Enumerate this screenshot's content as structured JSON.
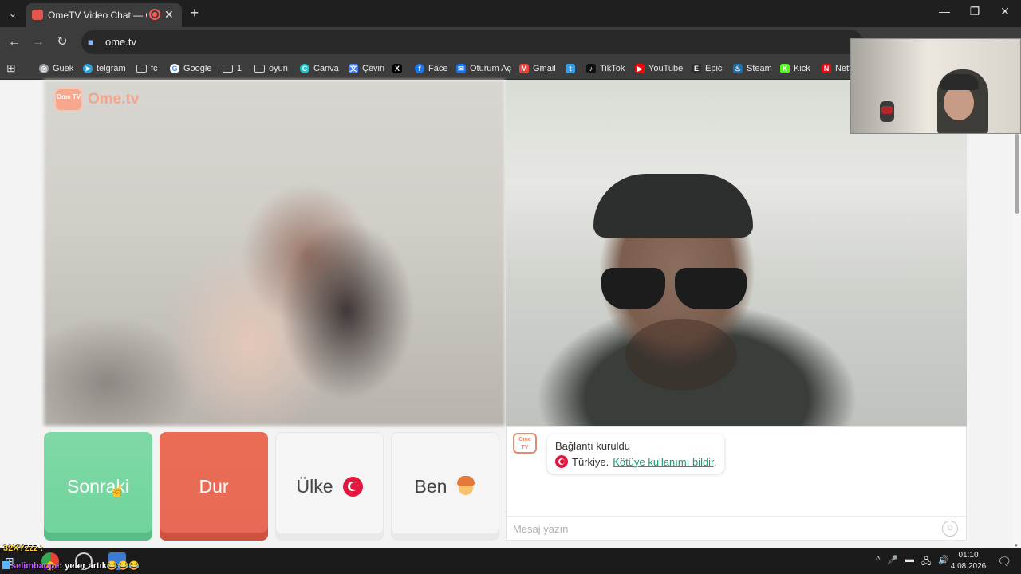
{
  "browser": {
    "tab_title": "OmeTV Video Chat — Ome",
    "tab_close": "✕",
    "new_tab": "+",
    "url": "ome.tv",
    "window_controls": {
      "minimize": "—",
      "maximize": "❐",
      "close": "✕"
    },
    "nav": {
      "back": "←",
      "forward": "→",
      "reload": "↻"
    },
    "bookmarks": [
      {
        "label": "Guek",
        "icon": "globe-icon",
        "color": "#9aa0a6"
      },
      {
        "label": "telgram",
        "icon": "telegram-icon",
        "color": "#2aa3e0"
      },
      {
        "label": "fc",
        "icon": "folder-icon",
        "color": "#3c3c3c"
      },
      {
        "label": "Google",
        "icon": "google-icon",
        "color": "#ffffff"
      },
      {
        "label": "1",
        "icon": "folder-icon",
        "color": "#3c3c3c"
      },
      {
        "label": "oyun",
        "icon": "folder-icon",
        "color": "#3c3c3c"
      },
      {
        "label": "Canva",
        "icon": "canva-icon",
        "color": "#20c4cb"
      },
      {
        "label": "Çeviri",
        "icon": "translate-icon",
        "color": "#4a7bf0"
      },
      {
        "label": "",
        "icon": "x-icon",
        "color": "#000000"
      },
      {
        "label": "Face",
        "icon": "facebook-icon",
        "color": "#1877f2"
      },
      {
        "label": "Oturum Aç",
        "icon": "mail-icon",
        "color": "#1a73e8"
      },
      {
        "label": "Gmail",
        "icon": "gmail-icon",
        "color": "#ea4335"
      },
      {
        "label": "",
        "icon": "tumblr-icon",
        "color": "#35a0e8"
      },
      {
        "label": "TikTok",
        "icon": "tiktok-icon",
        "color": "#111111"
      },
      {
        "label": "YouTube",
        "icon": "youtube-icon",
        "color": "#ff0000"
      },
      {
        "label": "Epic",
        "icon": "epic-icon",
        "color": "#2f2f2f"
      },
      {
        "label": "Steam",
        "icon": "steam-icon",
        "color": "#1b6fa8"
      },
      {
        "label": "Kick",
        "icon": "kick-icon",
        "color": "#53fc18"
      },
      {
        "label": "Netfl",
        "icon": "netflix-icon",
        "color": "#e50914"
      }
    ]
  },
  "ome": {
    "logo_text": "Ome.tv",
    "logo_badge": "Ome TV",
    "buttons": {
      "next": "Sonraki",
      "stop": "Dur",
      "country": "Ülke",
      "me": "Ben"
    },
    "chat": {
      "status": "Bağlantı kuruldu",
      "country": "Türkiye.",
      "report_link": "Kötüye kullanımı bildir",
      "report_suffix": ".",
      "input_placeholder": "Mesaj yazın",
      "emoji": "☺"
    }
  },
  "stream_overlay": {
    "name": "32XYzzz :",
    "chat_user": "selimbappe",
    "chat_message": ": yeter artık😂😂😂"
  },
  "taskbar": {
    "time": "01:10",
    "date": "4.08.2026",
    "tray": [
      "^",
      "🎤",
      "▬",
      "🖧",
      "🔊"
    ],
    "notification": "🗨"
  }
}
